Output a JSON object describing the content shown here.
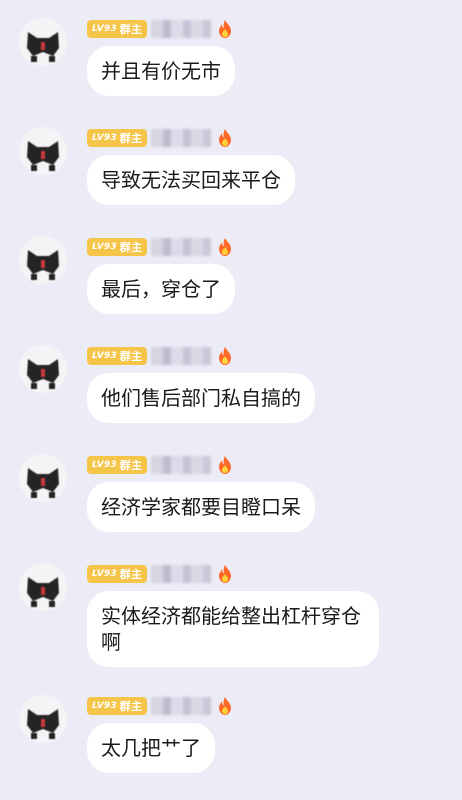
{
  "badge": {
    "level": "LV93",
    "role": "群主"
  },
  "messages": [
    {
      "text": "并且有价无市"
    },
    {
      "text": "导致无法买回来平仓"
    },
    {
      "text": "最后，穿仓了"
    },
    {
      "text": "他们售后部门私自搞的"
    },
    {
      "text": "经济学家都要目瞪口呆"
    },
    {
      "text": "实体经济都能给整出杠杆穿仓啊"
    },
    {
      "text": "太几把艹了"
    }
  ],
  "colors": {
    "background": "#ececf7",
    "bubble": "#ffffff",
    "badge": "#f5c54a",
    "fire": "#ff6a2a"
  },
  "icons": {
    "avatar": "pixelated-avatar",
    "flame": "fire-icon"
  }
}
